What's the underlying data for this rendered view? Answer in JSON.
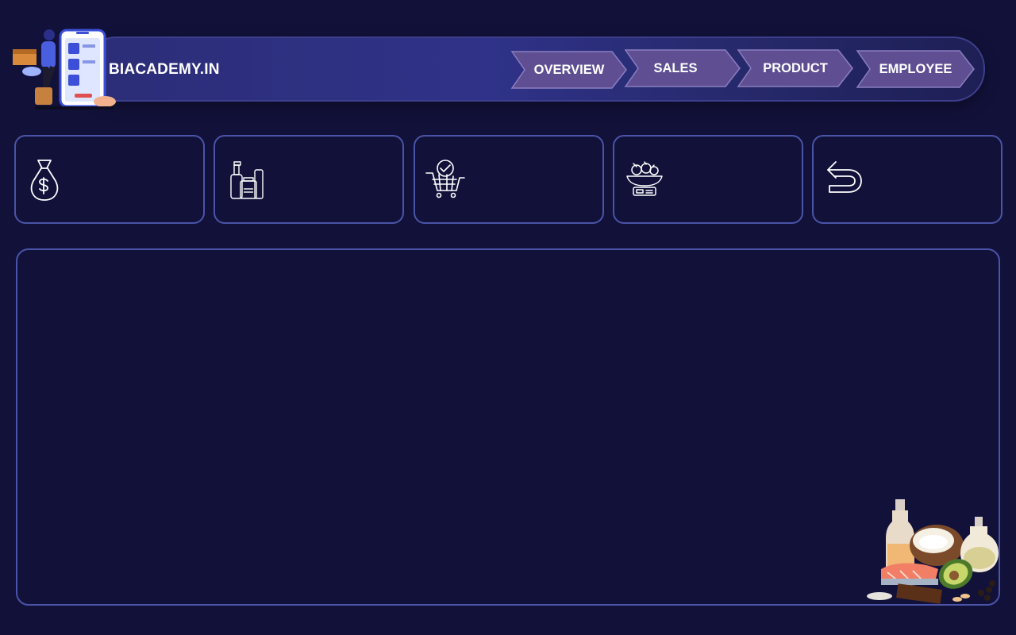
{
  "header": {
    "brand": "BIACADEMY.IN",
    "illustration_icon": "delivery-person-phone-illustration"
  },
  "nav": {
    "tabs": [
      {
        "label": "OVERVIEW"
      },
      {
        "label": "SALES"
      },
      {
        "label": "PRODUCT"
      },
      {
        "label": "EMPLOYEE"
      }
    ]
  },
  "kpi_cards": [
    {
      "icon": "money-bag-icon"
    },
    {
      "icon": "grocery-products-icon"
    },
    {
      "icon": "shopping-cart-check-icon"
    },
    {
      "icon": "produce-scale-icon"
    },
    {
      "icon": "return-arrow-icon"
    }
  ],
  "main_panel": {
    "illustration_icon": "healthy-food-illustration"
  },
  "colors": {
    "background": "#12113a",
    "header_bar": "#2f3288",
    "tab_fill": "#5f4f92",
    "card_border": "#4a54a8",
    "text": "#ffffff"
  }
}
